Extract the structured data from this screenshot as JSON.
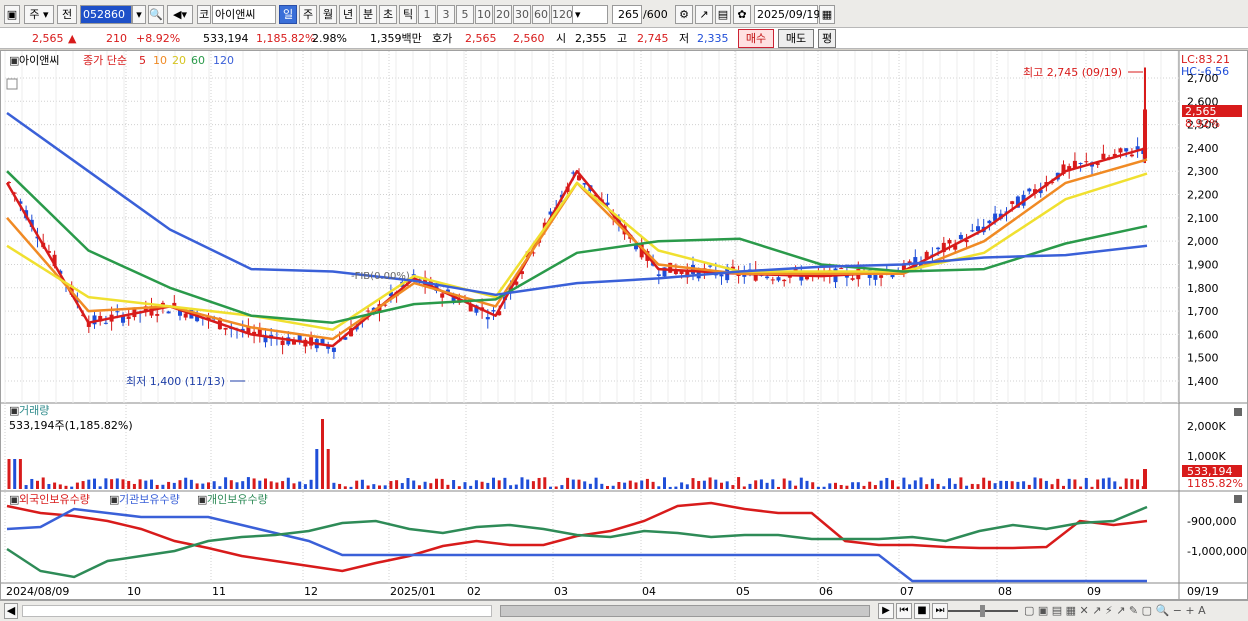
{
  "toolbar": {
    "period_select": "주",
    "prev_label": "전",
    "stock_code": "052860",
    "market_label": "코",
    "stock_name": "아이앤씨",
    "periods": [
      "일",
      "주",
      "월",
      "년",
      "분",
      "초",
      "틱"
    ],
    "active_period": "일",
    "intervals": [
      "1",
      "3",
      "5",
      "10",
      "20",
      "30",
      "60",
      "120"
    ],
    "count_display": "265",
    "count_total": "/600",
    "date": "2025/09/19"
  },
  "infobar": {
    "price": "2,565",
    "change": "210",
    "change_pct": "+8.92%",
    "volume": "533,194",
    "volume_pct": "1,185.82%",
    "turnover": "2.98%",
    "amount": "1,359백만",
    "quote_label": "호가",
    "ask": "2,565",
    "bid": "2,560",
    "open_label": "시",
    "open": "2,355",
    "high_label": "고",
    "high": "2,745",
    "low_label": "저",
    "low": "2,335",
    "buy_label": "매수",
    "sell_label": "매도",
    "eval_label": "평"
  },
  "price_panel": {
    "stock_name": "아이앤씨",
    "ma_label": "종가 단순",
    "ma_periods": [
      "5",
      "10",
      "20",
      "60",
      "120"
    ],
    "lc": "LC:83.21",
    "hc": "HC:-6.56",
    "high_annotation": "최고 2,745 (09/19)",
    "low_annotation": "최저 1,400 (11/13)",
    "watermark": "-FIB(0.00%)",
    "price_tag": "2,565",
    "pct_tag": "8.92%"
  },
  "volume_panel": {
    "title": "거래량",
    "value": "533,194주(1,185.82%)",
    "axis_label": "2,000K",
    "axis_label_mid": "1,000K",
    "tag_value": "533,194",
    "tag_pct": "1185.82%"
  },
  "holding_panel": {
    "series": [
      {
        "name": "외국인보유수량",
        "color": "#d81b1b"
      },
      {
        "name": "기관보유수량",
        "color": "#3a60d8"
      },
      {
        "name": "개인보유수량",
        "color": "#2e8b57"
      }
    ],
    "axis_labels": [
      "-900,000",
      "-1,000,000"
    ]
  },
  "x_axis": {
    "labels": [
      "2024/08/09",
      "10",
      "11",
      "12",
      "2025/01",
      "02",
      "03",
      "04",
      "05",
      "06",
      "07",
      "08",
      "09"
    ],
    "end_label": "09/19"
  },
  "chart_data": {
    "type": "line",
    "title": "",
    "ylabel": "",
    "ylim": [
      1400,
      2700
    ],
    "y_ticks": [
      1400,
      1500,
      1600,
      1700,
      1800,
      1900,
      2000,
      2100,
      2200,
      2300,
      2400,
      2500,
      2600,
      2700
    ],
    "x": [
      "2024/08/09",
      "2024/09",
      "2024/10",
      "2024/11",
      "2024/12",
      "2025/01",
      "2025/02",
      "2025/03",
      "2025/04",
      "2025/05",
      "2025/06",
      "2025/07",
      "2025/08",
      "2025/09",
      "2025/09/19"
    ],
    "series": [
      {
        "name": "5",
        "color": "#d81b1b",
        "values": [
          2250,
          1650,
          1720,
          1600,
          1550,
          1840,
          1680,
          2300,
          1880,
          1860,
          1850,
          1870,
          2050,
          2300,
          2400
        ]
      },
      {
        "name": "10",
        "color": "#f08a24",
        "values": [
          2100,
          1700,
          1720,
          1630,
          1580,
          1820,
          1720,
          2250,
          1900,
          1860,
          1860,
          1860,
          2000,
          2250,
          2350
        ]
      },
      {
        "name": "20",
        "color": "#f0e030",
        "values": [
          1980,
          1760,
          1720,
          1680,
          1620,
          1850,
          1760,
          2250,
          1960,
          1870,
          1870,
          1870,
          1950,
          2180,
          2290
        ]
      },
      {
        "name": "60",
        "color": "#2a9a4a",
        "values": [
          2300,
          1960,
          1800,
          1680,
          1650,
          1730,
          1750,
          1950,
          2000,
          2010,
          1900,
          1870,
          1880,
          1990,
          2065
        ]
      },
      {
        "name": "120",
        "color": "#3a60d8",
        "values": [
          2550,
          2300,
          2050,
          1880,
          1870,
          1830,
          1770,
          1820,
          1840,
          1870,
          1890,
          1900,
          1930,
          1940,
          1980
        ]
      }
    ]
  },
  "footer": {
    "nav_buttons": [
      "▶",
      "⏮",
      "■",
      "⏭"
    ]
  },
  "colors": {
    "up": "#d81b1b",
    "down": "#1f4ed8",
    "background": "#ffffff",
    "grid": "#c8c8c8"
  }
}
